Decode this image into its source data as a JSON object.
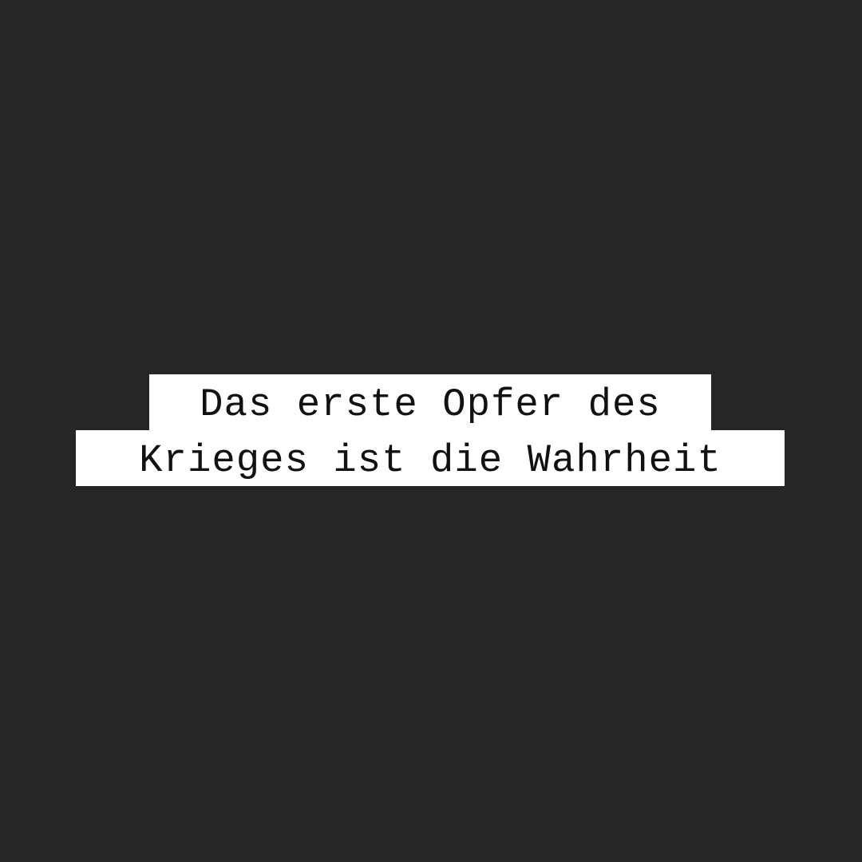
{
  "background_color": "#262626",
  "highlight_color": "#ffffff",
  "text_color": "#111111",
  "quote": {
    "line1": "Das erste Opfer des",
    "line2": "Krieges ist die Wahrheit"
  }
}
